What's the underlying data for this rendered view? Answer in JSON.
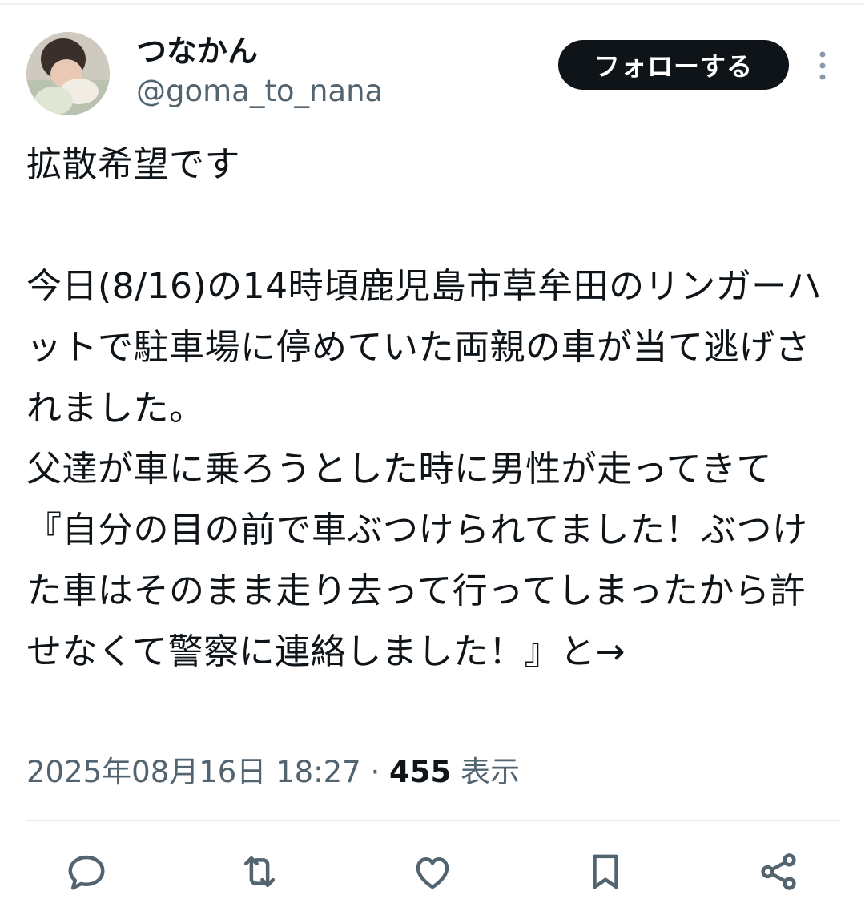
{
  "author": {
    "display_name": "つなかん",
    "handle": "@goma_to_nana"
  },
  "follow_button": "フォローする",
  "more_icon": "more-vertical-icon",
  "tweet": {
    "text": "拡散希望です\n\n今日(8/16)の14時頃鹿児島市草牟田のリンガーハットで駐車場に停めていた両親の車が当て逃げされました。\n父達が車に乗ろうとした時に男性が走ってきて『自分の目の前で車ぶつけられてました！ぶつけた車はそのまま走り去って行ってしまったから許せなくて警察に連絡しました！』と→"
  },
  "meta": {
    "timestamp": "2025年08月16日 18:27",
    "separator": "·",
    "views_count": "455",
    "views_label": "表示"
  },
  "actions": [
    {
      "icon": "reply-icon"
    },
    {
      "icon": "retweet-icon"
    },
    {
      "icon": "like-icon"
    },
    {
      "icon": "bookmark-icon"
    },
    {
      "icon": "share-icon"
    }
  ],
  "colors": {
    "text": "#0f1419",
    "secondary": "#536471",
    "button_bg": "#0f1419",
    "divider": "#e5e9ea"
  }
}
